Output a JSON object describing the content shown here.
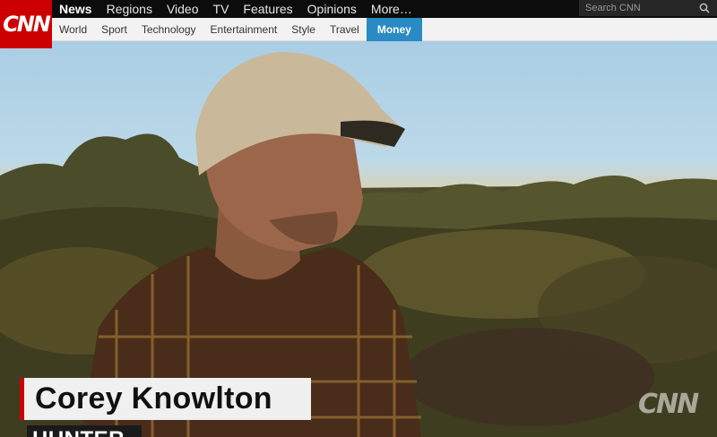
{
  "brand": {
    "logo": "CNN",
    "color": "#cc0000"
  },
  "main_nav": [
    {
      "label": "News",
      "active": true
    },
    {
      "label": "Regions"
    },
    {
      "label": "Video"
    },
    {
      "label": "TV"
    },
    {
      "label": "Features"
    },
    {
      "label": "Opinions"
    },
    {
      "label": "More…"
    }
  ],
  "search": {
    "placeholder": "Search CNN",
    "icon": "search-icon"
  },
  "sub_nav": [
    {
      "label": "World"
    },
    {
      "label": "Sport"
    },
    {
      "label": "Technology"
    },
    {
      "label": "Entertainment"
    },
    {
      "label": "Style"
    },
    {
      "label": "Travel"
    },
    {
      "label": "Money",
      "active": true,
      "color": "#2a8ac4"
    }
  ],
  "video": {
    "lower_third": {
      "name": "Corey Knowlton",
      "title": "HUNTER"
    },
    "watermark": "CNN"
  }
}
